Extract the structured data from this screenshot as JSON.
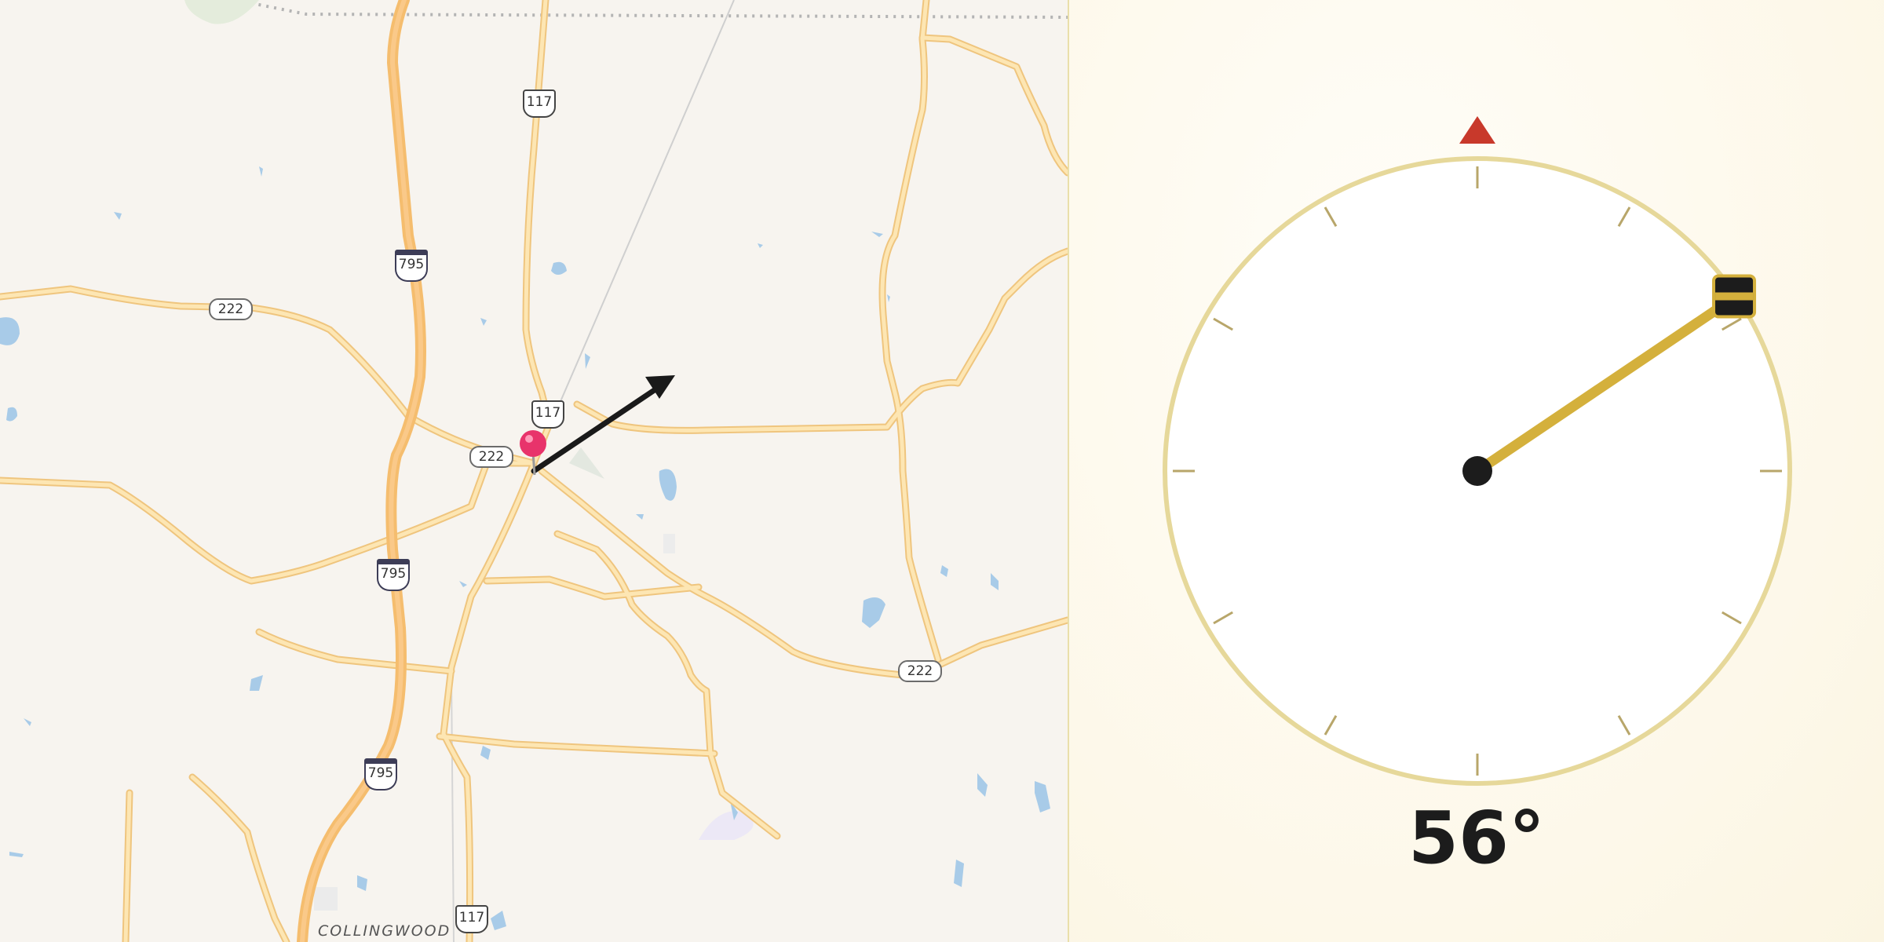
{
  "map": {
    "place_label": "COLLINGWOOD",
    "shields": {
      "us_117_top": "117",
      "us_117_center": "117",
      "us_117_bottom": "117",
      "i_795_top": "795",
      "i_795_mid": "795",
      "i_795_bottom": "795",
      "state_222_west": "222",
      "state_222_center": "222",
      "state_222_east": "222"
    },
    "colors": {
      "background": "#f7f4ef",
      "road_casing": "#f0c77a",
      "road_fill": "#fde3a8",
      "interstate": "#f7bf6b",
      "water": "#a8cbe8",
      "pin": "#e8336b",
      "arrow": "#1a1a1a"
    }
  },
  "compass": {
    "heading_degrees": 56,
    "heading_label": "56°",
    "north_marker_icon": "north-triangle-icon",
    "colors": {
      "ring": "#e6d89a",
      "face": "#ffffff",
      "tick": "#b8a66a",
      "needle": "#d4b03c",
      "north_marker": "#c8392b",
      "hub": "#1c1c1c"
    }
  }
}
